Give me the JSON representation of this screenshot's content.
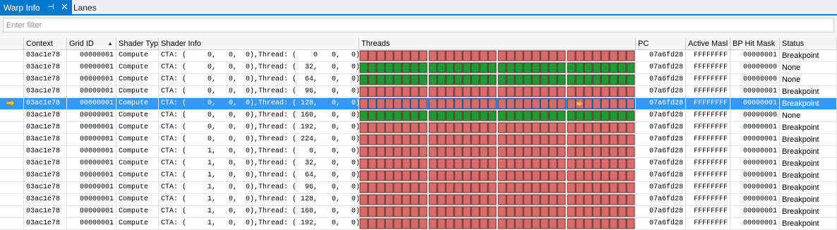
{
  "tabs": {
    "active": {
      "label": "Warp Info",
      "pin_glyph": "⊣",
      "close_glyph": "✕"
    },
    "inactive": {
      "label": "Lanes"
    }
  },
  "filter": {
    "placeholder": "Enter filter",
    "value": ""
  },
  "columns": {
    "context": "Context",
    "grid_id": "Grid ID",
    "shader_type": "Shader Typ",
    "shader_info": "Shader Info",
    "threads": "Threads",
    "pc": "PC",
    "active_mask": "Active Masl",
    "bp_hit_mask": "BP Hit Mask",
    "status": "Status"
  },
  "colors": {
    "lane_red": "#d96b6b",
    "lane_green": "#1f9a34",
    "lane_border": "#4d1a1a",
    "selected_row": "#3399ff",
    "accent": "#007acc",
    "arrow": "#f0c330"
  },
  "threads_legend": {
    "lanes_per_warp": 32,
    "lanes_per_group": 8
  },
  "rows": [
    {
      "context": "03ac1e78",
      "grid_id": "00000001",
      "shader_type": "Compute",
      "cta_label": "CTA: (",
      "cta_x": "0,",
      "cta_y": "0,",
      "cta_z": "0),",
      "thread_label": "Thread: (",
      "thread_x": "0",
      "thread_y": "0,",
      "thread_z": "0)",
      "pc": "07a6fd28",
      "active_mask": "FFFFFFFF",
      "bp_hit_mask": "00000001",
      "status": "Breakpoint",
      "lane_state": "red",
      "selected": false,
      "current": false
    },
    {
      "context": "03ac1e78",
      "grid_id": "00000001",
      "shader_type": "Compute",
      "cta_label": "CTA: (",
      "cta_x": "0,",
      "cta_y": "0,",
      "cta_z": "0),",
      "thread_label": "Thread: (",
      "thread_x": "32,",
      "thread_y": "0,",
      "thread_z": "0)",
      "pc": "07a6fd28",
      "active_mask": "FFFFFFFF",
      "bp_hit_mask": "00000000",
      "status": "None",
      "lane_state": "green",
      "selected": false,
      "current": false
    },
    {
      "context": "03ac1e78",
      "grid_id": "00000001",
      "shader_type": "Compute",
      "cta_label": "CTA: (",
      "cta_x": "0,",
      "cta_y": "0,",
      "cta_z": "0),",
      "thread_label": "Thread: (",
      "thread_x": "64,",
      "thread_y": "0,",
      "thread_z": "0)",
      "pc": "07a6fd28",
      "active_mask": "FFFFFFFF",
      "bp_hit_mask": "00000000",
      "status": "None",
      "lane_state": "green",
      "selected": false,
      "current": false
    },
    {
      "context": "03ac1e78",
      "grid_id": "00000001",
      "shader_type": "Compute",
      "cta_label": "CTA: (",
      "cta_x": "0,",
      "cta_y": "0,",
      "cta_z": "0),",
      "thread_label": "Thread: (",
      "thread_x": "96,",
      "thread_y": "0,",
      "thread_z": "0)",
      "pc": "07a6fd28",
      "active_mask": "FFFFFFFF",
      "bp_hit_mask": "00000001",
      "status": "Breakpoint",
      "lane_state": "red",
      "selected": false,
      "current": false
    },
    {
      "context": "03ac1e78",
      "grid_id": "00000001",
      "shader_type": "Compute",
      "cta_label": "CTA: (",
      "cta_x": "0,",
      "cta_y": "0,",
      "cta_z": "0),",
      "thread_label": "Thread: (",
      "thread_x": "128,",
      "thread_y": "0,",
      "thread_z": "0)",
      "pc": "07a6fd28",
      "active_mask": "FFFFFFFF",
      "bp_hit_mask": "00000001",
      "status": "Breakpoint",
      "lane_state": "red",
      "selected": true,
      "current": true,
      "current_lane": 25
    },
    {
      "context": "03ac1e78",
      "grid_id": "00000001",
      "shader_type": "Compute",
      "cta_label": "CTA: (",
      "cta_x": "0,",
      "cta_y": "0,",
      "cta_z": "0),",
      "thread_label": "Thread: (",
      "thread_x": "160,",
      "thread_y": "0,",
      "thread_z": "0)",
      "pc": "07a6fd28",
      "active_mask": "FFFFFFFF",
      "bp_hit_mask": "00000000",
      "status": "None",
      "lane_state": "green",
      "selected": false,
      "current": false
    },
    {
      "context": "03ac1e78",
      "grid_id": "00000001",
      "shader_type": "Compute",
      "cta_label": "CTA: (",
      "cta_x": "0,",
      "cta_y": "0,",
      "cta_z": "0),",
      "thread_label": "Thread: (",
      "thread_x": "192,",
      "thread_y": "0,",
      "thread_z": "0)",
      "pc": "07a6fd28",
      "active_mask": "FFFFFFFF",
      "bp_hit_mask": "00000001",
      "status": "Breakpoint",
      "lane_state": "red",
      "selected": false,
      "current": false
    },
    {
      "context": "03ac1e78",
      "grid_id": "00000001",
      "shader_type": "Compute",
      "cta_label": "CTA: (",
      "cta_x": "0,",
      "cta_y": "0,",
      "cta_z": "0),",
      "thread_label": "Thread: (",
      "thread_x": "224,",
      "thread_y": "0,",
      "thread_z": "0)",
      "pc": "07a6fd28",
      "active_mask": "FFFFFFFF",
      "bp_hit_mask": "00000001",
      "status": "Breakpoint",
      "lane_state": "red",
      "selected": false,
      "current": false
    },
    {
      "context": "03ac1e78",
      "grid_id": "00000001",
      "shader_type": "Compute",
      "cta_label": "CTA: (",
      "cta_x": "1,",
      "cta_y": "0,",
      "cta_z": "0),",
      "thread_label": "Thread: (",
      "thread_x": "0,",
      "thread_y": "0,",
      "thread_z": "0)",
      "pc": "07a6fd28",
      "active_mask": "FFFFFFFF",
      "bp_hit_mask": "00000001",
      "status": "Breakpoint",
      "lane_state": "red",
      "selected": false,
      "current": false
    },
    {
      "context": "03ac1e78",
      "grid_id": "00000001",
      "shader_type": "Compute",
      "cta_label": "CTA: (",
      "cta_x": "1,",
      "cta_y": "0,",
      "cta_z": "0),",
      "thread_label": "Thread: (",
      "thread_x": "32,",
      "thread_y": "0,",
      "thread_z": "0)",
      "pc": "07a6fd28",
      "active_mask": "FFFFFFFF",
      "bp_hit_mask": "00000001",
      "status": "Breakpoint",
      "lane_state": "red",
      "selected": false,
      "current": false
    },
    {
      "context": "03ac1e78",
      "grid_id": "00000001",
      "shader_type": "Compute",
      "cta_label": "CTA: (",
      "cta_x": "1,",
      "cta_y": "0,",
      "cta_z": "0),",
      "thread_label": "Thread: (",
      "thread_x": "64,",
      "thread_y": "0,",
      "thread_z": "0)",
      "pc": "07a6fd28",
      "active_mask": "FFFFFFFF",
      "bp_hit_mask": "00000001",
      "status": "Breakpoint",
      "lane_state": "red",
      "selected": false,
      "current": false
    },
    {
      "context": "03ac1e78",
      "grid_id": "00000001",
      "shader_type": "Compute",
      "cta_label": "CTA: (",
      "cta_x": "1,",
      "cta_y": "0,",
      "cta_z": "0),",
      "thread_label": "Thread: (",
      "thread_x": "96,",
      "thread_y": "0,",
      "thread_z": "0)",
      "pc": "07a6fd28",
      "active_mask": "FFFFFFFF",
      "bp_hit_mask": "00000001",
      "status": "Breakpoint",
      "lane_state": "red",
      "selected": false,
      "current": false
    },
    {
      "context": "03ac1e78",
      "grid_id": "00000001",
      "shader_type": "Compute",
      "cta_label": "CTA: (",
      "cta_x": "1,",
      "cta_y": "0,",
      "cta_z": "0),",
      "thread_label": "Thread: (",
      "thread_x": "128,",
      "thread_y": "0,",
      "thread_z": "0)",
      "pc": "07a6fd28",
      "active_mask": "FFFFFFFF",
      "bp_hit_mask": "00000001",
      "status": "Breakpoint",
      "lane_state": "red",
      "selected": false,
      "current": false
    },
    {
      "context": "03ac1e78",
      "grid_id": "00000001",
      "shader_type": "Compute",
      "cta_label": "CTA: (",
      "cta_x": "1,",
      "cta_y": "0,",
      "cta_z": "0),",
      "thread_label": "Thread: (",
      "thread_x": "160,",
      "thread_y": "0,",
      "thread_z": "0)",
      "pc": "07a6fd28",
      "active_mask": "FFFFFFFF",
      "bp_hit_mask": "00000001",
      "status": "Breakpoint",
      "lane_state": "red",
      "selected": false,
      "current": false
    },
    {
      "context": "03ac1e78",
      "grid_id": "00000001",
      "shader_type": "Compute",
      "cta_label": "CTA: (",
      "cta_x": "1,",
      "cta_y": "0,",
      "cta_z": "0),",
      "thread_label": "Thread: (",
      "thread_x": "192,",
      "thread_y": "0,",
      "thread_z": "0)",
      "pc": "07a6fd28",
      "active_mask": "FFFFFFFF",
      "bp_hit_mask": "00000001",
      "status": "Breakpoint",
      "lane_state": "red",
      "selected": false,
      "current": false
    }
  ]
}
